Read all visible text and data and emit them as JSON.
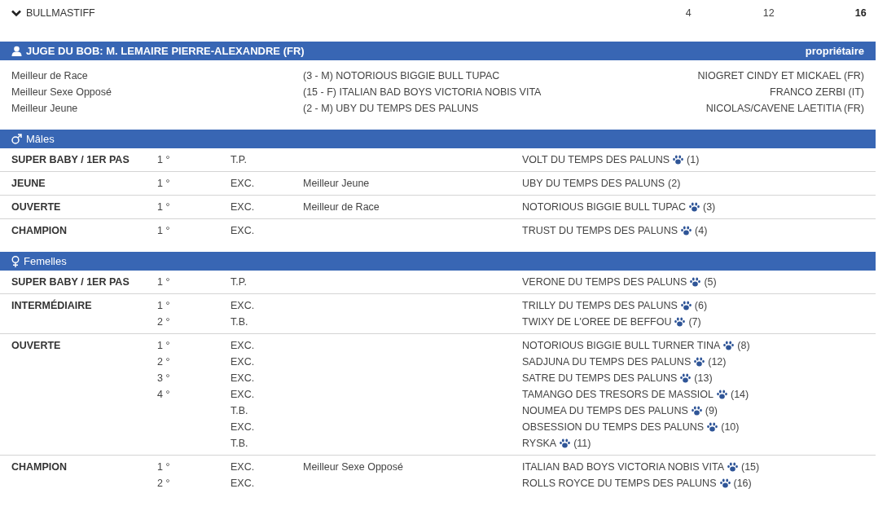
{
  "breed": {
    "name": "BULLMASTIFF",
    "expanded": true,
    "counts": [
      {
        "value": "4",
        "bold": false
      },
      {
        "value": "12",
        "bold": false
      },
      {
        "value": "16",
        "bold": true
      }
    ]
  },
  "judge": {
    "title": "JUGE DU BOB: M. LEMAIRE PIERRE-ALEXANDRE (FR)",
    "owner_heading": "propriétaire"
  },
  "awards": [
    {
      "label": "Meilleur de Race",
      "dog": "(3 - M) NOTORIOUS BIGGIE BULL TUPAC",
      "owner": "NIOGRET CINDY ET MICKAEL (FR)"
    },
    {
      "label": "Meilleur Sexe Opposé",
      "dog": "(15 - F) ITALIAN BAD BOYS VICTORIA NOBIS VITA",
      "owner": "FRANCO ZERBI (IT)"
    },
    {
      "label": "Meilleur Jeune",
      "dog": "(2 - M) UBY DU TEMPS DES PALUNS",
      "owner": "NICOLAS/CAVENE LAETITIA (FR)"
    }
  ],
  "sections": [
    {
      "kind": "male",
      "title": "Mâles",
      "classes": [
        {
          "name": "SUPER BABY / 1ER PAS",
          "entries": [
            {
              "rank": "1 °",
              "grade": "T.P.",
              "dog": "VOLT DU TEMPS DES PALUNS",
              "paw": true,
              "number": "(1)"
            }
          ]
        },
        {
          "name": "JEUNE",
          "entries": [
            {
              "rank": "1 °",
              "grade": "EXC.",
              "award": "Meilleur Jeune",
              "dog": "UBY DU TEMPS DES PALUNS",
              "paw": false,
              "number": "(2)"
            }
          ]
        },
        {
          "name": "OUVERTE",
          "entries": [
            {
              "rank": "1 °",
              "grade": "EXC.",
              "award": "Meilleur de Race",
              "dog": "NOTORIOUS BIGGIE BULL TUPAC",
              "paw": true,
              "number": "(3)"
            }
          ]
        },
        {
          "name": "CHAMPION",
          "entries": [
            {
              "rank": "1 °",
              "grade": "EXC.",
              "dog": "TRUST DU TEMPS DES PALUNS",
              "paw": true,
              "number": "(4)"
            }
          ]
        }
      ]
    },
    {
      "kind": "female",
      "title": "Femelles",
      "classes": [
        {
          "name": "SUPER BABY / 1ER PAS",
          "entries": [
            {
              "rank": "1 °",
              "grade": "T.P.",
              "dog": "VERONE DU TEMPS DES PALUNS",
              "paw": true,
              "number": "(5)"
            }
          ]
        },
        {
          "name": "INTERMÉDIAIRE",
          "entries": [
            {
              "rank": "1 °",
              "grade": "EXC.",
              "dog": "TRILLY DU TEMPS DES PALUNS",
              "paw": true,
              "number": "(6)"
            },
            {
              "rank": "2 °",
              "grade": "T.B.",
              "dog": "TWIXY DE L'OREE DE BEFFOU",
              "paw": true,
              "number": "(7)"
            }
          ]
        },
        {
          "name": "OUVERTE",
          "entries": [
            {
              "rank": "1 °",
              "grade": "EXC.",
              "dog": "NOTORIOUS BIGGIE BULL TURNER TINA",
              "paw": true,
              "number": "(8)"
            },
            {
              "rank": "2 °",
              "grade": "EXC.",
              "dog": "SADJUNA DU TEMPS DES PALUNS",
              "paw": true,
              "number": "(12)"
            },
            {
              "rank": "3 °",
              "grade": "EXC.",
              "dog": "SATRE DU TEMPS DES PALUNS",
              "paw": true,
              "number": "(13)"
            },
            {
              "rank": "4 °",
              "grade": "EXC.",
              "dog": "TAMANGO DES TRESORS DE MASSIOL",
              "paw": true,
              "number": "(14)"
            },
            {
              "grade": "T.B.",
              "dog": "NOUMEA DU TEMPS DES PALUNS",
              "paw": true,
              "number": "(9)"
            },
            {
              "grade": "EXC.",
              "dog": "OBSESSION DU TEMPS DES PALUNS",
              "paw": true,
              "number": "(10)"
            },
            {
              "grade": "T.B.",
              "dog": "RYSKA",
              "paw": true,
              "number": "(11)"
            }
          ]
        },
        {
          "name": "CHAMPION",
          "entries": [
            {
              "rank": "1 °",
              "grade": "EXC.",
              "award": "Meilleur Sexe Opposé",
              "dog": "ITALIAN BAD BOYS VICTORIA NOBIS VITA",
              "paw": true,
              "number": "(15)"
            },
            {
              "rank": "2 °",
              "grade": "EXC.",
              "dog": "ROLLS ROYCE DU TEMPS DES PALUNS",
              "paw": true,
              "number": "(16)"
            }
          ]
        }
      ]
    }
  ]
}
